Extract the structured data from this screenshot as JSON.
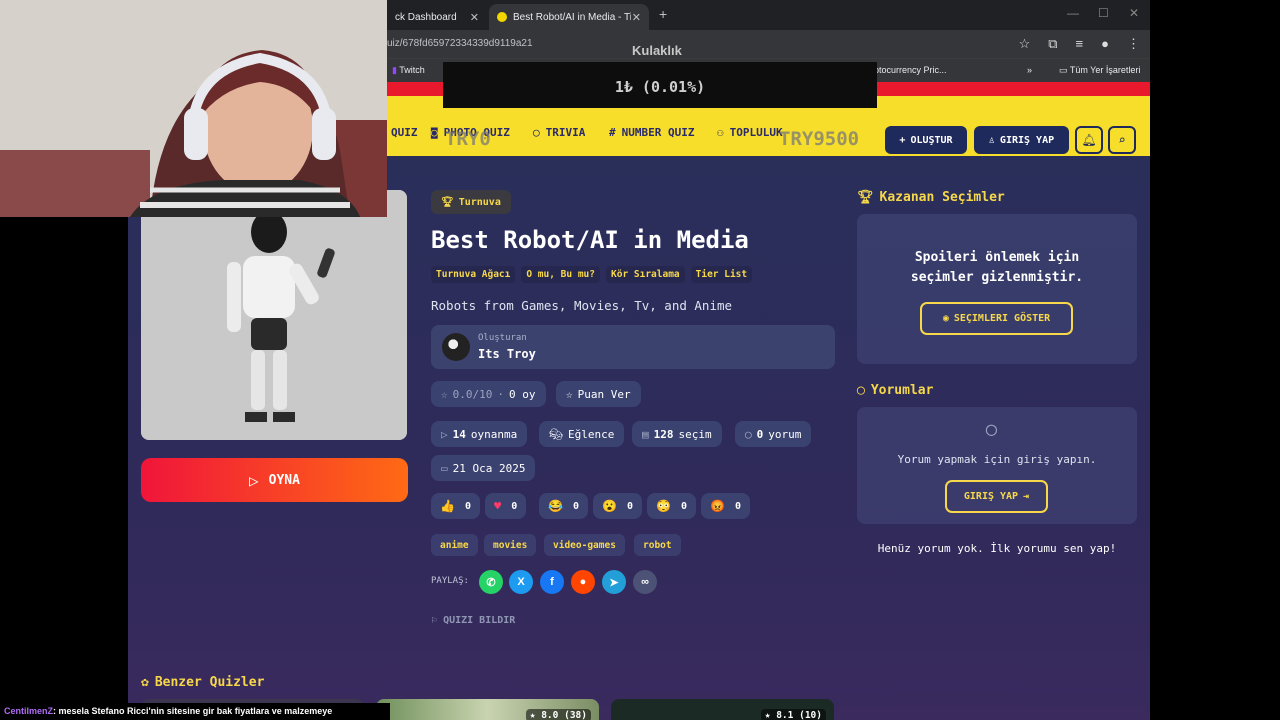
{
  "browser": {
    "tabs": [
      {
        "label": "ck Dashboard"
      },
      {
        "label": "Best Robot/AI in Media - Tier Li"
      }
    ],
    "url": "uiz/678fd65972334339d9119a21",
    "bookmarks": {
      "twitch": "Twitch",
      "crypto": "ptocurrency Pric...",
      "all": "Tüm Yer İşaretleri"
    }
  },
  "overlay": {
    "goal_label": "Kulaklık",
    "amount": "1₺ (0.01%)",
    "try_left": "TRY0",
    "try_right": "TRY9500"
  },
  "header": {
    "nav": {
      "quiz": "QUIZ",
      "photo_quiz": "PHOTO QUIZ",
      "trivia": "TRIVIA",
      "number_quiz": "NUMBER QUIZ",
      "community": "TOPLULUK"
    },
    "create_label": "OLUŞTUR",
    "login_label": "GIRIŞ YAP"
  },
  "quiz": {
    "badge": "Turnuva",
    "title": "Best Robot/AI in Media",
    "types": [
      "Turnuva Ağacı",
      "O mu, Bu mu?",
      "Kör Sıralama",
      "Tier List"
    ],
    "description": "Robots from Games, Movies, Tv, and Anime",
    "creator_label": "Oluşturan",
    "creator_name": "Its Troy",
    "rating": "0.0/10",
    "votes": "0 oy",
    "rate_label": "Puan Ver",
    "plays_count": "14",
    "plays_label": "oynanma",
    "category": "Eğlence",
    "choices_count": "128",
    "choices_label": "seçim",
    "comments_count": "0",
    "comments_label": "yorum",
    "date": "21 Oca 2025",
    "play_label": "OYNA",
    "reactions": [
      "0",
      "0",
      "0",
      "0",
      "0",
      "0"
    ],
    "topics": [
      "anime",
      "movies",
      "video-games",
      "robot"
    ],
    "share_label": "PAYLAŞ:",
    "report_label": "QUIZI BILDIR"
  },
  "sidebar": {
    "winners_title": "Kazanan Seçimler",
    "spoiler_line1": "Spoileri önlemek için",
    "spoiler_line2": "seçimler gizlenmiştir.",
    "reveal_label": "SEÇIMLERI GÖSTER",
    "comments_title": "Yorumlar",
    "comment_prompt": "Yorum yapmak için giriş yapın.",
    "comment_login_label": "GIRIŞ YAP",
    "no_comments": "Henüz yorum yok. İlk yorumu sen yap!"
  },
  "similar": {
    "title": "Benzer Quizler",
    "cards": [
      {
        "rating": "8.0",
        "votes": "(38)"
      },
      {
        "rating": "8.1",
        "votes": "(10)"
      }
    ]
  },
  "chat": {
    "user": "CentilmenZ",
    "message": ": mesela Stefano Ricci'nin sitesine gir bak fiyatlara ve malzemeye"
  },
  "colors": {
    "header_yellow": "#f7de2a",
    "accent_red": "#e8192c",
    "gold": "#f7d84a",
    "navy": "#1f2a5c"
  }
}
